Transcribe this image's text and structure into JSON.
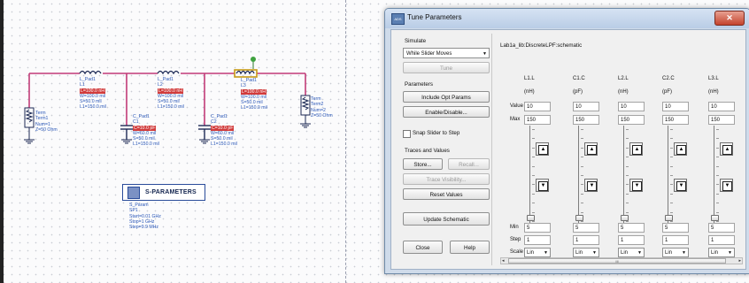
{
  "schematic": {
    "components": [
      {
        "id": "term1",
        "lines": [
          "Term",
          "Term1",
          "Num=1",
          "Z=50 Ohm"
        ]
      },
      {
        "id": "term2",
        "lines": [
          "Term",
          "Term2",
          "Num=2",
          "Z=50 Ohm"
        ]
      },
      {
        "id": "l1",
        "head": "L_Pad1",
        "name": "L1",
        "hl": "L=100.0 nH",
        "lines": [
          "W=100.0 mil",
          "S=50.0 mil",
          "L1=150.0 mil"
        ]
      },
      {
        "id": "l2",
        "head": "L_Pad1",
        "name": "L2",
        "hl": "L=100.0 nH",
        "lines": [
          "W=100.0 mil",
          "S=50.0 mil",
          "L1=150.0 mil"
        ]
      },
      {
        "id": "l3",
        "head": "L_Pad1",
        "name": "L3",
        "hl": "L=100.0 nH",
        "lines": [
          "W=100.0 mil",
          "S=50.0 mil",
          "L1=150.0 mil"
        ]
      },
      {
        "id": "c1",
        "head": "C_Pad1",
        "name": "C1",
        "hl": "C=10.0 pF",
        "lines": [
          "W=60.0 mil",
          "S=50.0 mil",
          "L1=150.0 mil"
        ]
      },
      {
        "id": "c2",
        "head": "C_Pad1",
        "name": "C2",
        "hl": "C=10.0 pF",
        "lines": [
          "W=60.0 mil",
          "S=50.0 mil",
          "L1=150.0 mil"
        ]
      }
    ],
    "sparams": {
      "title": "S-PARAMETERS",
      "lines": [
        "S_Param",
        "SP1",
        "Start=0.01 GHz",
        "Stop=1 GHz",
        "Step=9.9 MHz"
      ]
    }
  },
  "dialog": {
    "title": "Tune Parameters",
    "close_glyph": "✕",
    "icon_text": "ADS",
    "simulate_label": "Simulate",
    "simulate_mode": "While Slider Moves",
    "tune_button": "Tune",
    "parameters_label": "Parameters",
    "include_opt_button": "Include Opt Params",
    "enable_disable_button": "Enable/Disable...",
    "snap_label": "Snap Slider to Step",
    "traces_label": "Traces and Values",
    "store_button": "Store...",
    "recall_button": "Recall...",
    "trace_visibility_button": "Trace Visibility...",
    "reset_values_button": "Reset Values",
    "update_schematic_button": "Update Schematic",
    "close_button": "Close",
    "help_button": "Help",
    "schematic_path": "Lab1a_lib:DiscreteLPF:schematic",
    "row_labels": {
      "value": "Value",
      "max": "Max",
      "min": "Min",
      "step": "Step",
      "scale": "Scale"
    },
    "scroll_grip": "III",
    "params": [
      {
        "name": "L1.L",
        "unit": "(nH)",
        "value": "10",
        "max": "150",
        "min": "5",
        "step": "1",
        "scale": "Lin",
        "slider_fraction": 0.03
      },
      {
        "name": "C1.C",
        "unit": "(pF)",
        "value": "10",
        "max": "150",
        "min": "5",
        "step": "1",
        "scale": "Lin",
        "slider_fraction": 0.03
      },
      {
        "name": "L2.L",
        "unit": "(nH)",
        "value": "10",
        "max": "150",
        "min": "5",
        "step": "1",
        "scale": "Lin",
        "slider_fraction": 0.03
      },
      {
        "name": "C2.C",
        "unit": "(pF)",
        "value": "10",
        "max": "150",
        "min": "5",
        "step": "1",
        "scale": "Lin",
        "slider_fraction": 0.03
      },
      {
        "name": "L3.L",
        "unit": "(nH)",
        "value": "10",
        "max": "150",
        "min": "5",
        "step": "1",
        "scale": "Lin",
        "slider_fraction": 0.03
      }
    ]
  }
}
